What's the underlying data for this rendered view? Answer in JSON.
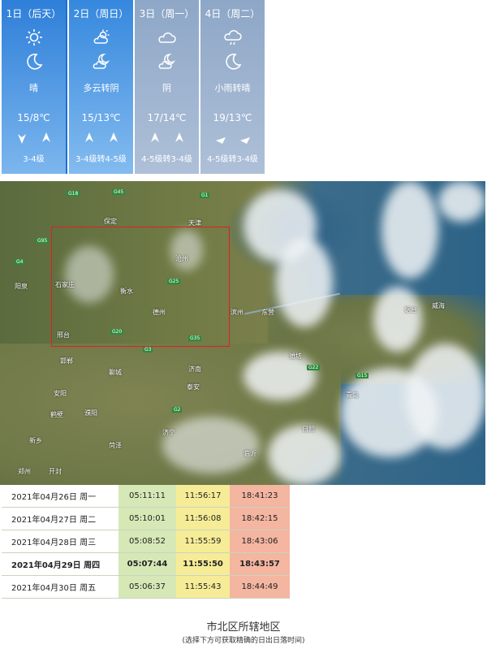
{
  "forecast": [
    {
      "label": "1日（后天）",
      "day_icon": "sun-icon",
      "night_icon": "moon-icon",
      "condition": "晴",
      "temp": "15/8℃",
      "wind": "3-4级"
    },
    {
      "label": "2日（周日）",
      "day_icon": "partly-cloudy-icon",
      "night_icon": "cloudy-night-icon",
      "condition": "多云转阴",
      "temp": "15/13℃",
      "wind": "3-4级转4-5级"
    },
    {
      "label": "3日（周一）",
      "day_icon": "cloud-icon",
      "night_icon": "cloudy-night-icon",
      "condition": "阴",
      "temp": "17/14℃",
      "wind": "4-5级转3-4级"
    },
    {
      "label": "4日（周二）",
      "day_icon": "rain-cloud-icon",
      "night_icon": "moon-icon",
      "condition": "小雨转晴",
      "temp": "19/13℃",
      "wind": "4-5级转3-4级"
    }
  ],
  "map": {
    "cities": [
      "保定",
      "天津",
      "石家庄",
      "衡水",
      "德州",
      "沧州",
      "邢台",
      "东营",
      "滨州",
      "烟台",
      "威海",
      "潍坊",
      "青岛",
      "济南",
      "泰安",
      "聊城",
      "邯郸",
      "安阳",
      "鹤壁",
      "新乡",
      "濮阳",
      "菏泽",
      "济宁",
      "郑州",
      "开封",
      "阳泉",
      "临沂",
      "日照"
    ],
    "roads": [
      "G18",
      "G45",
      "G1",
      "G95",
      "G4",
      "G25",
      "G20",
      "G3",
      "G35",
      "G22",
      "G15",
      "G2"
    ]
  },
  "sun_table": {
    "rows": [
      {
        "date": "2021年04月26日 周一",
        "rise": "05:11:11",
        "noon": "11:56:17",
        "set": "18:41:23",
        "bold": false
      },
      {
        "date": "2021年04月27日 周二",
        "rise": "05:10:01",
        "noon": "11:56:08",
        "set": "18:42:15",
        "bold": false
      },
      {
        "date": "2021年04月28日 周三",
        "rise": "05:08:52",
        "noon": "11:55:59",
        "set": "18:43:06",
        "bold": false
      },
      {
        "date": "2021年04月29日 周四",
        "rise": "05:07:44",
        "noon": "11:55:50",
        "set": "18:43:57",
        "bold": true
      },
      {
        "date": "2021年04月30日 周五",
        "rise": "05:06:37",
        "noon": "11:55:43",
        "set": "18:44:49",
        "bold": false
      }
    ]
  },
  "district": {
    "title": "市北区所辖地区",
    "note": "(选择下方可获取精确的日出日落时间)"
  },
  "colors": {
    "today_bg": "#2e7fd9",
    "future_bg": "#8ea7c7",
    "sunrise_cell": "#d5e8b6",
    "noon_cell": "#f6ec97",
    "sunset_cell": "#f4b5a1",
    "region_box": "#e02020"
  }
}
